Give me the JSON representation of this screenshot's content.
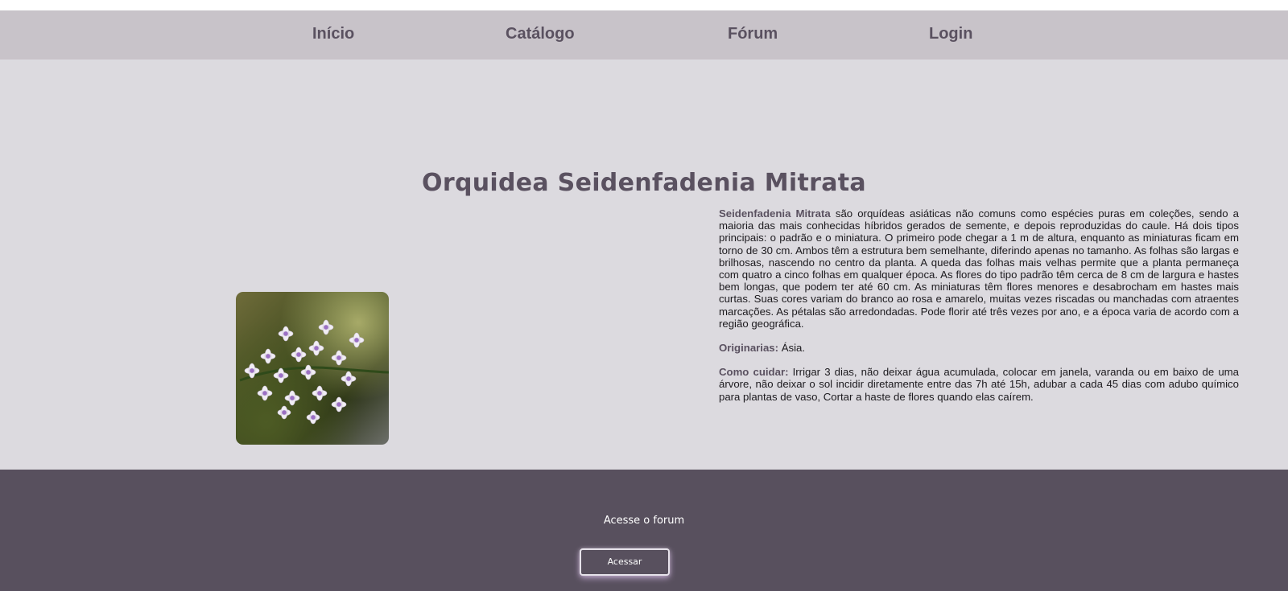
{
  "nav": {
    "items": [
      {
        "label": "Início"
      },
      {
        "label": "Catálogo"
      },
      {
        "label": "Fórum"
      },
      {
        "label": "Login"
      }
    ]
  },
  "main": {
    "title": "Orquidea Seidenfadenia Mitrata",
    "image_icon": "orchid-photo",
    "description": {
      "name_bold": "Seidenfadenia Mitrata",
      "text": " são orquídeas asiáticas não comuns como espécies puras em coleções, sendo a maioria das mais conhecidas híbridos gerados de semente, e depois reproduzidas do caule. Há dois tipos principais: o padrão e o miniatura. O primeiro pode chegar a 1 m de altura, enquanto as miniaturas ficam em torno de 30 cm. Ambos têm a estrutura bem semelhante, diferindo apenas no tamanho. As folhas são largas e brilhosas, nascendo no centro da planta. A queda das folhas mais velhas permite que a planta permaneça com quatro a cinco folhas em qualquer época. As flores do tipo padrão têm cerca de 8 cm de largura e hastes bem longas, que podem ter até 60 cm. As miniaturas têm flores menores e desabrocham em hastes mais curtas. Suas cores variam do branco ao rosa e amarelo, muitas vezes riscadas ou manchadas com atraentes marcações. As pétalas são arredondadas. Pode florir até três vezes por ano, e a época varia de acordo com a região geográfica."
    },
    "origin": {
      "label": "Originarias:",
      "value": " Ásia."
    },
    "care": {
      "label": "Como cuidar:",
      "value": " Irrigar 3 dias, não deixar água acumulada, colocar em janela, varanda ou em baixo de uma árvore, não deixar o sol incidir diretamente entre das 7h até 15h, adubar a cada 45 dias com adubo químico para plantas de vaso, Cortar a haste de flores quando elas caírem."
    }
  },
  "footer": {
    "text": "Acesse o forum",
    "button_label": "Acessar"
  },
  "colors": {
    "nav_bg": "#c8c3c9",
    "main_bg": "#dcdadf",
    "footer_bg": "#58505e",
    "accent_text": "#5a5160"
  }
}
